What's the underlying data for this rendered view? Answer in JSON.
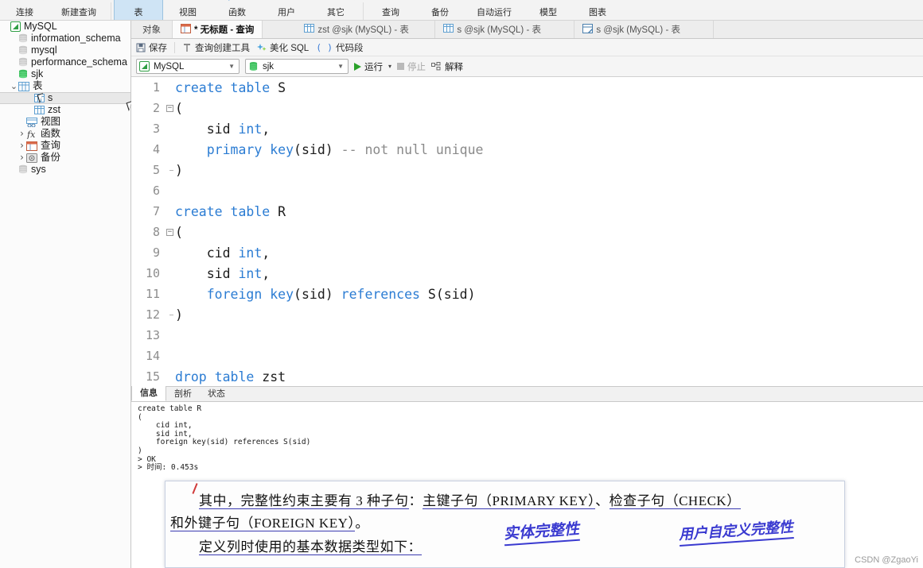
{
  "ribbon": {
    "items": [
      {
        "label": "连接",
        "icon": "connection-icon",
        "active": false,
        "caret": true
      },
      {
        "label": "新建查询",
        "icon": "new-query-icon",
        "active": false,
        "caret": false
      },
      {
        "label": "表",
        "icon": "table-icon",
        "active": true,
        "caret": false
      },
      {
        "label": "视图",
        "icon": "view-icon",
        "active": false,
        "caret": false
      },
      {
        "label": "函数",
        "icon": "function-icon",
        "active": false,
        "caret": false
      },
      {
        "label": "用户",
        "icon": "user-icon",
        "active": false,
        "caret": false
      },
      {
        "label": "其它",
        "icon": "other-icon",
        "active": false,
        "caret": true
      },
      {
        "label": "查询",
        "icon": "query-icon",
        "active": false,
        "caret": false
      },
      {
        "label": "备份",
        "icon": "backup-icon",
        "active": false,
        "caret": false
      },
      {
        "label": "自动运行",
        "icon": "automation-icon",
        "active": false,
        "caret": false
      },
      {
        "label": "模型",
        "icon": "model-icon",
        "active": false,
        "caret": false
      },
      {
        "label": "图表",
        "icon": "chart-icon",
        "active": false,
        "caret": false
      }
    ]
  },
  "sidebar": {
    "nodes": [
      {
        "label": "MySQL",
        "icon": "connection-icon",
        "indent": 0,
        "twisty": "",
        "selected": false
      },
      {
        "label": "information_schema",
        "icon": "database-icon",
        "indent": 1,
        "twisty": "",
        "selected": false
      },
      {
        "label": "mysql",
        "icon": "database-icon",
        "indent": 1,
        "twisty": "",
        "selected": false
      },
      {
        "label": "performance_schema",
        "icon": "database-icon",
        "indent": 1,
        "twisty": "",
        "selected": false
      },
      {
        "label": "sjk",
        "icon": "database-open-icon",
        "indent": 1,
        "twisty": "",
        "selected": false
      },
      {
        "label": "表",
        "icon": "table-folder-icon",
        "indent": 1,
        "twisty": "v",
        "selected": false
      },
      {
        "label": "s",
        "icon": "table-icon",
        "indent": 3,
        "twisty": "",
        "selected": true
      },
      {
        "label": "zst",
        "icon": "table-icon",
        "indent": 3,
        "twisty": "",
        "selected": false
      },
      {
        "label": "视图",
        "icon": "view-folder-icon",
        "indent": 2,
        "twisty": "",
        "selected": false
      },
      {
        "label": "函数",
        "icon": "function-folder-icon",
        "indent": 2,
        "twisty": ">",
        "selected": false
      },
      {
        "label": "查询",
        "icon": "query-folder-icon",
        "indent": 2,
        "twisty": ">",
        "selected": false
      },
      {
        "label": "备份",
        "icon": "backup-folder-icon",
        "indent": 2,
        "twisty": ">",
        "selected": false
      },
      {
        "label": "sys",
        "icon": "database-icon",
        "indent": 1,
        "twisty": "",
        "selected": false
      }
    ]
  },
  "tabs": {
    "object_label": "对象",
    "items": [
      {
        "label": "* 无标题 - 查询",
        "icon": "query-tab-icon",
        "active": true
      },
      {
        "label": "zst @sjk (MySQL) - 表",
        "icon": "table-tab-icon",
        "active": false
      },
      {
        "label": "s @sjk (MySQL) - 表",
        "icon": "table-tab-icon",
        "active": false
      },
      {
        "label": "s @sjk (MySQL) - 表",
        "icon": "table-design-tab-icon",
        "active": false
      }
    ]
  },
  "query_toolbar": {
    "save": "保存",
    "query_builder": "查询创建工具",
    "beautify": "美化 SQL",
    "snippet": "代码段"
  },
  "query_bar": {
    "connection": "MySQL",
    "database": "sjk",
    "run": "运行",
    "stop": "停止",
    "explain": "解释"
  },
  "editor": {
    "lines": [
      {
        "no": "1",
        "fold": "start-none",
        "tokens": [
          {
            "t": "create",
            "c": "kw"
          },
          {
            "t": " ",
            "c": ""
          },
          {
            "t": "table",
            "c": "kw"
          },
          {
            "t": " S",
            "c": ""
          }
        ]
      },
      {
        "no": "2",
        "fold": "start",
        "tokens": [
          {
            "t": "(",
            "c": ""
          }
        ]
      },
      {
        "no": "3",
        "fold": "mid",
        "tokens": [
          {
            "t": "    sid ",
            "c": ""
          },
          {
            "t": "int",
            "c": "kw"
          },
          {
            "t": ",",
            "c": ""
          }
        ]
      },
      {
        "no": "4",
        "fold": "mid",
        "tokens": [
          {
            "t": "    ",
            "c": ""
          },
          {
            "t": "primary key",
            "c": "kw"
          },
          {
            "t": "(sid) ",
            "c": ""
          },
          {
            "t": "-- not null unique",
            "c": "cmt"
          }
        ]
      },
      {
        "no": "5",
        "fold": "end",
        "tokens": [
          {
            "t": ")",
            "c": ""
          }
        ]
      },
      {
        "no": "6",
        "fold": "none",
        "tokens": []
      },
      {
        "no": "7",
        "fold": "none",
        "tokens": [
          {
            "t": "create",
            "c": "kw"
          },
          {
            "t": " ",
            "c": ""
          },
          {
            "t": "table",
            "c": "kw"
          },
          {
            "t": " R",
            "c": ""
          }
        ]
      },
      {
        "no": "8",
        "fold": "start",
        "tokens": [
          {
            "t": "(",
            "c": ""
          }
        ]
      },
      {
        "no": "9",
        "fold": "mid",
        "tokens": [
          {
            "t": "    cid ",
            "c": ""
          },
          {
            "t": "int",
            "c": "kw"
          },
          {
            "t": ",",
            "c": ""
          }
        ]
      },
      {
        "no": "10",
        "fold": "mid",
        "tokens": [
          {
            "t": "    sid ",
            "c": ""
          },
          {
            "t": "int",
            "c": "kw"
          },
          {
            "t": ",",
            "c": ""
          }
        ]
      },
      {
        "no": "11",
        "fold": "mid",
        "tokens": [
          {
            "t": "    ",
            "c": ""
          },
          {
            "t": "foreign key",
            "c": "kw"
          },
          {
            "t": "(sid) ",
            "c": ""
          },
          {
            "t": "references",
            "c": "kw"
          },
          {
            "t": " S(sid)",
            "c": ""
          }
        ]
      },
      {
        "no": "12",
        "fold": "end",
        "tokens": [
          {
            "t": ")",
            "c": ""
          }
        ]
      },
      {
        "no": "13",
        "fold": "none",
        "tokens": []
      },
      {
        "no": "14",
        "fold": "none",
        "tokens": []
      },
      {
        "no": "15",
        "fold": "none",
        "tokens": [
          {
            "t": "drop",
            "c": "kw"
          },
          {
            "t": " ",
            "c": ""
          },
          {
            "t": "table",
            "c": "kw"
          },
          {
            "t": " zst",
            "c": ""
          }
        ]
      }
    ]
  },
  "results": {
    "tabs": [
      {
        "label": "信息",
        "active": true
      },
      {
        "label": "剖析",
        "active": false
      },
      {
        "label": "状态",
        "active": false
      }
    ],
    "output": "create table R\n(\n    cid int,\n    sid int,\n    foreign key(sid) references S(sid)\n)\n> OK\n> 时间: 0.453s"
  },
  "overlay": {
    "line1_a": "其中，",
    "line1_b": "完整性约束主要有 3 种子句",
    "line1_c": "：",
    "line1_d": "主键子句",
    "line1_e": "（PRIMARY KEY）",
    "line1_f": "、",
    "line1_g": "检查子句",
    "line1_h": "（CHECK）",
    "line2_a": "和外键子句",
    "line2_b": "（FOREIGN KEY）",
    "line2_c": "。",
    "line3": "定义列时使用的基本数据类型如下：",
    "hand1": "实体完整性",
    "hand2": "用户自定义完整性"
  },
  "watermark": "CSDN @ZgaoYi",
  "colors": {
    "keyword": "#2b7cd3",
    "comment": "#8a8a8a",
    "accent_run": "#2aa12a",
    "tab_active": "#cfe4f5",
    "selection": "#e8e8e8",
    "handwriting": "#3a3ad0"
  }
}
